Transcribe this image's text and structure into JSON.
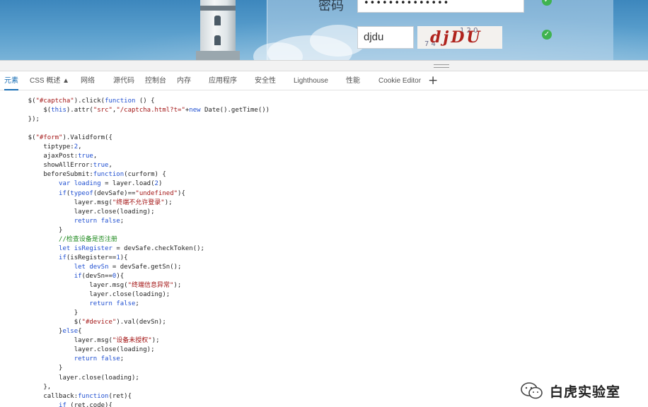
{
  "login_form": {
    "password_label": "密码",
    "password_value": "••••••••••••••",
    "captcha_value": "djdu",
    "captcha_image_text": "djDU",
    "captcha_noise": [
      "1 2 0",
      "7 4"
    ],
    "valid_color": "#3fb34f"
  },
  "devtools": {
    "tabs": [
      {
        "label": "元素",
        "active": true
      },
      {
        "label": "CSS 概述 ▲",
        "active": false
      },
      {
        "label": "网络",
        "active": false
      },
      {
        "label": "源代码",
        "active": false
      },
      {
        "label": "控制台",
        "active": false
      },
      {
        "label": "内存",
        "active": false
      },
      {
        "label": "应用程序",
        "active": false
      },
      {
        "label": "安全性",
        "active": false
      },
      {
        "label": "Lighthouse",
        "active": false
      },
      {
        "label": "性能",
        "active": false
      },
      {
        "label": "Cookie Editor",
        "active": false
      }
    ],
    "add_tab_label": "+",
    "accent_color": "#1a6fb5"
  },
  "code": {
    "lines": [
      [
        [
          "n",
          "    $("
        ],
        [
          "s",
          "\"#captcha\""
        ],
        [
          "n",
          ").click("
        ],
        [
          "k",
          "function"
        ],
        [
          "n",
          " () {"
        ]
      ],
      [
        [
          "n",
          "        $("
        ],
        [
          "k",
          "this"
        ],
        [
          "n",
          ").attr("
        ],
        [
          "s",
          "\"src\""
        ],
        [
          "n",
          ","
        ],
        [
          "s",
          "\"/captcha.html?t=\""
        ],
        [
          "n",
          "+"
        ],
        [
          "k",
          "new"
        ],
        [
          "n",
          " Date().getTime())"
        ]
      ],
      [
        [
          "n",
          "    });"
        ]
      ],
      [
        [
          "n",
          ""
        ]
      ],
      [
        [
          "n",
          "    $("
        ],
        [
          "s",
          "\"#form\""
        ],
        [
          "n",
          ").Validform({"
        ]
      ],
      [
        [
          "n",
          "        tiptype:"
        ],
        [
          "m",
          "2"
        ],
        [
          "n",
          ","
        ]
      ],
      [
        [
          "n",
          "        ajaxPost:"
        ],
        [
          "k",
          "true"
        ],
        [
          "n",
          ","
        ]
      ],
      [
        [
          "n",
          "        showAllError:"
        ],
        [
          "k",
          "true"
        ],
        [
          "n",
          ","
        ]
      ],
      [
        [
          "n",
          "        beforeSubmit:"
        ],
        [
          "k",
          "function"
        ],
        [
          "n",
          "(curform) {"
        ]
      ],
      [
        [
          "n",
          "            "
        ],
        [
          "k",
          "var"
        ],
        [
          "n",
          " "
        ],
        [
          "k",
          "loading"
        ],
        [
          "n",
          " = layer.load("
        ],
        [
          "m",
          "2"
        ],
        [
          "n",
          ")"
        ]
      ],
      [
        [
          "n",
          "            "
        ],
        [
          "k",
          "if"
        ],
        [
          "n",
          "("
        ],
        [
          "k",
          "typeof"
        ],
        [
          "n",
          "(devSafe)=="
        ],
        [
          "s",
          "\"undefined\""
        ],
        [
          "n",
          "){"
        ]
      ],
      [
        [
          "n",
          "                layer.msg("
        ],
        [
          "s",
          "\"终端不允许登录\""
        ],
        [
          "n",
          ");"
        ]
      ],
      [
        [
          "n",
          "                layer.close(loading);"
        ]
      ],
      [
        [
          "n",
          "                "
        ],
        [
          "k",
          "return"
        ],
        [
          "n",
          " "
        ],
        [
          "k",
          "false"
        ],
        [
          "n",
          ";"
        ]
      ],
      [
        [
          "n",
          "            }"
        ]
      ],
      [
        [
          "c",
          "            //检查设备是否注册"
        ]
      ],
      [
        [
          "n",
          "            "
        ],
        [
          "k",
          "let"
        ],
        [
          "n",
          " "
        ],
        [
          "k",
          "isRegister"
        ],
        [
          "n",
          " = devSafe.checkToken();"
        ]
      ],
      [
        [
          "n",
          "            "
        ],
        [
          "k",
          "if"
        ],
        [
          "n",
          "(isRegister=="
        ],
        [
          "m",
          "1"
        ],
        [
          "n",
          "){"
        ]
      ],
      [
        [
          "n",
          "                "
        ],
        [
          "k",
          "let"
        ],
        [
          "n",
          " "
        ],
        [
          "k",
          "devSn"
        ],
        [
          "n",
          " = devSafe.getSn();"
        ]
      ],
      [
        [
          "n",
          "                "
        ],
        [
          "k",
          "if"
        ],
        [
          "n",
          "(devSn=="
        ],
        [
          "m",
          "0"
        ],
        [
          "n",
          "){"
        ]
      ],
      [
        [
          "n",
          "                    layer.msg("
        ],
        [
          "s",
          "\"终端信息异常\""
        ],
        [
          "n",
          ");"
        ]
      ],
      [
        [
          "n",
          "                    layer.close(loading);"
        ]
      ],
      [
        [
          "n",
          "                    "
        ],
        [
          "k",
          "return"
        ],
        [
          "n",
          " "
        ],
        [
          "k",
          "false"
        ],
        [
          "n",
          ";"
        ]
      ],
      [
        [
          "n",
          "                }"
        ]
      ],
      [
        [
          "n",
          "                $("
        ],
        [
          "s",
          "\"#device\""
        ],
        [
          "n",
          ").val(devSn);"
        ]
      ],
      [
        [
          "n",
          "            }"
        ],
        [
          "k",
          "else"
        ],
        [
          "n",
          "{"
        ]
      ],
      [
        [
          "n",
          "                layer.msg("
        ],
        [
          "s",
          "\"设备未授权\""
        ],
        [
          "n",
          ");"
        ]
      ],
      [
        [
          "n",
          "                layer.close(loading);"
        ]
      ],
      [
        [
          "n",
          "                "
        ],
        [
          "k",
          "return"
        ],
        [
          "n",
          " "
        ],
        [
          "k",
          "false"
        ],
        [
          "n",
          ";"
        ]
      ],
      [
        [
          "n",
          "            }"
        ]
      ],
      [
        [
          "n",
          "            layer.close(loading);"
        ]
      ],
      [
        [
          "n",
          "        },"
        ]
      ],
      [
        [
          "n",
          "        callback:"
        ],
        [
          "k",
          "function"
        ],
        [
          "n",
          "(ret){"
        ]
      ],
      [
        [
          "n",
          "            "
        ],
        [
          "k",
          "if"
        ],
        [
          "n",
          " (ret.code){"
        ]
      ]
    ]
  },
  "watermark": {
    "text": "白虎实验室",
    "icon": "wechat-icon"
  }
}
